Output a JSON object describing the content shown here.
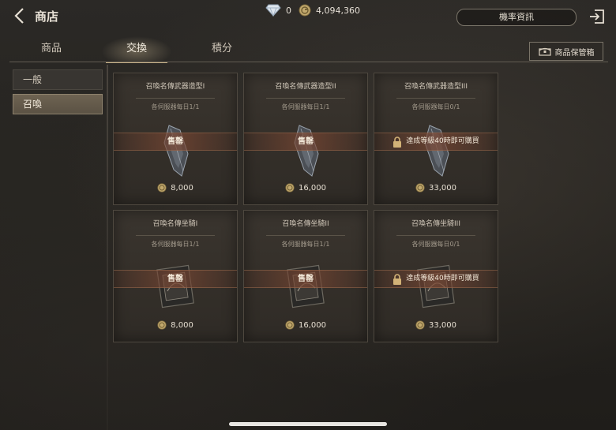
{
  "header": {
    "title": "商店"
  },
  "currencies": {
    "diamond": "0",
    "gold": "4,094,360"
  },
  "rate_button": "機率資訊",
  "tabs": [
    {
      "label": "商品"
    },
    {
      "label": "交換"
    },
    {
      "label": "積分"
    }
  ],
  "active_tab": "交換",
  "storage_button": "商品保管箱",
  "sidebar": {
    "items": [
      {
        "label": "一般"
      },
      {
        "label": "召喚"
      }
    ],
    "active": "召喚"
  },
  "cards": [
    {
      "name": "召喚名傳武器造型I",
      "limit": "各伺服器每日1/1",
      "status": "售罄",
      "price": "8,000",
      "art": "weapon"
    },
    {
      "name": "召喚名傳武器造型II",
      "limit": "各伺服器每日1/1",
      "status": "售罄",
      "price": "16,000",
      "art": "weapon"
    },
    {
      "name": "召喚名傳武器造型III",
      "limit": "各伺服器每日0/1",
      "status": "達成等級40時即可購買",
      "price": "33,000",
      "art": "weapon",
      "locked": true
    },
    {
      "name": "召喚名傳坐騎I",
      "limit": "各伺服器每日1/1",
      "status": "售罄",
      "price": "8,000",
      "art": "mount"
    },
    {
      "name": "召喚名傳坐騎II",
      "limit": "各伺服器每日1/1",
      "status": "售罄",
      "price": "16,000",
      "art": "mount"
    },
    {
      "name": "召喚名傳坐騎III",
      "limit": "各伺服器每日0/1",
      "status": "達成等級40時即可購買",
      "price": "33,000",
      "art": "mount",
      "locked": true
    }
  ],
  "icons": {
    "back": "chevron-left-icon",
    "diamond": "diamond-icon",
    "gold": "gold-coin-icon",
    "exit": "exit-icon",
    "storage": "chest-icon",
    "lock": "lock-icon",
    "price": "gold-coin-icon"
  },
  "colors": {
    "accent": "#c9b38a",
    "sold_band": "#7a4632",
    "text": "#d8cfc2"
  }
}
